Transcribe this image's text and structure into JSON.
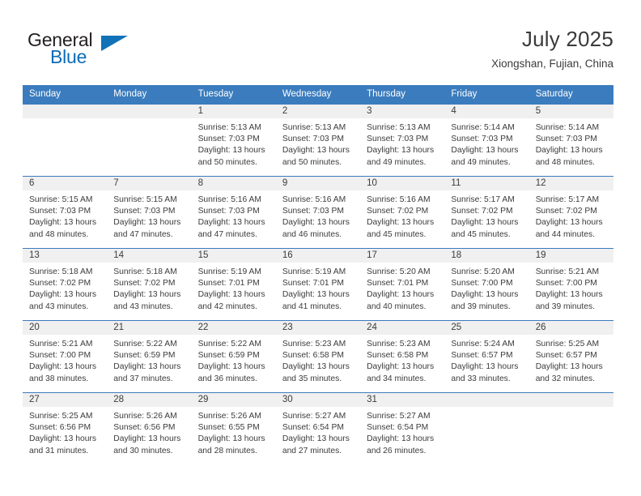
{
  "brand": {
    "word1": "General",
    "word2": "Blue",
    "triangle_color": "#1272b8",
    "blue": "#0a6cb8"
  },
  "header": {
    "title": "July 2025",
    "subtitle": "Xiongshan, Fujian, China"
  },
  "theme": {
    "header_bg": "#3a7cbe",
    "daynum_bg": "#f0f0f0",
    "text": "#3b3b3b"
  },
  "weekday_headers": [
    "Sunday",
    "Monday",
    "Tuesday",
    "Wednesday",
    "Thursday",
    "Friday",
    "Saturday"
  ],
  "weeks": [
    [
      {
        "day": ""
      },
      {
        "day": ""
      },
      {
        "day": "1",
        "sunrise": "Sunrise: 5:13 AM",
        "sunset": "Sunset: 7:03 PM",
        "daylight": "Daylight: 13 hours and 50 minutes."
      },
      {
        "day": "2",
        "sunrise": "Sunrise: 5:13 AM",
        "sunset": "Sunset: 7:03 PM",
        "daylight": "Daylight: 13 hours and 50 minutes."
      },
      {
        "day": "3",
        "sunrise": "Sunrise: 5:13 AM",
        "sunset": "Sunset: 7:03 PM",
        "daylight": "Daylight: 13 hours and 49 minutes."
      },
      {
        "day": "4",
        "sunrise": "Sunrise: 5:14 AM",
        "sunset": "Sunset: 7:03 PM",
        "daylight": "Daylight: 13 hours and 49 minutes."
      },
      {
        "day": "5",
        "sunrise": "Sunrise: 5:14 AM",
        "sunset": "Sunset: 7:03 PM",
        "daylight": "Daylight: 13 hours and 48 minutes."
      }
    ],
    [
      {
        "day": "6",
        "sunrise": "Sunrise: 5:15 AM",
        "sunset": "Sunset: 7:03 PM",
        "daylight": "Daylight: 13 hours and 48 minutes."
      },
      {
        "day": "7",
        "sunrise": "Sunrise: 5:15 AM",
        "sunset": "Sunset: 7:03 PM",
        "daylight": "Daylight: 13 hours and 47 minutes."
      },
      {
        "day": "8",
        "sunrise": "Sunrise: 5:16 AM",
        "sunset": "Sunset: 7:03 PM",
        "daylight": "Daylight: 13 hours and 47 minutes."
      },
      {
        "day": "9",
        "sunrise": "Sunrise: 5:16 AM",
        "sunset": "Sunset: 7:03 PM",
        "daylight": "Daylight: 13 hours and 46 minutes."
      },
      {
        "day": "10",
        "sunrise": "Sunrise: 5:16 AM",
        "sunset": "Sunset: 7:02 PM",
        "daylight": "Daylight: 13 hours and 45 minutes."
      },
      {
        "day": "11",
        "sunrise": "Sunrise: 5:17 AM",
        "sunset": "Sunset: 7:02 PM",
        "daylight": "Daylight: 13 hours and 45 minutes."
      },
      {
        "day": "12",
        "sunrise": "Sunrise: 5:17 AM",
        "sunset": "Sunset: 7:02 PM",
        "daylight": "Daylight: 13 hours and 44 minutes."
      }
    ],
    [
      {
        "day": "13",
        "sunrise": "Sunrise: 5:18 AM",
        "sunset": "Sunset: 7:02 PM",
        "daylight": "Daylight: 13 hours and 43 minutes."
      },
      {
        "day": "14",
        "sunrise": "Sunrise: 5:18 AM",
        "sunset": "Sunset: 7:02 PM",
        "daylight": "Daylight: 13 hours and 43 minutes."
      },
      {
        "day": "15",
        "sunrise": "Sunrise: 5:19 AM",
        "sunset": "Sunset: 7:01 PM",
        "daylight": "Daylight: 13 hours and 42 minutes."
      },
      {
        "day": "16",
        "sunrise": "Sunrise: 5:19 AM",
        "sunset": "Sunset: 7:01 PM",
        "daylight": "Daylight: 13 hours and 41 minutes."
      },
      {
        "day": "17",
        "sunrise": "Sunrise: 5:20 AM",
        "sunset": "Sunset: 7:01 PM",
        "daylight": "Daylight: 13 hours and 40 minutes."
      },
      {
        "day": "18",
        "sunrise": "Sunrise: 5:20 AM",
        "sunset": "Sunset: 7:00 PM",
        "daylight": "Daylight: 13 hours and 39 minutes."
      },
      {
        "day": "19",
        "sunrise": "Sunrise: 5:21 AM",
        "sunset": "Sunset: 7:00 PM",
        "daylight": "Daylight: 13 hours and 39 minutes."
      }
    ],
    [
      {
        "day": "20",
        "sunrise": "Sunrise: 5:21 AM",
        "sunset": "Sunset: 7:00 PM",
        "daylight": "Daylight: 13 hours and 38 minutes."
      },
      {
        "day": "21",
        "sunrise": "Sunrise: 5:22 AM",
        "sunset": "Sunset: 6:59 PM",
        "daylight": "Daylight: 13 hours and 37 minutes."
      },
      {
        "day": "22",
        "sunrise": "Sunrise: 5:22 AM",
        "sunset": "Sunset: 6:59 PM",
        "daylight": "Daylight: 13 hours and 36 minutes."
      },
      {
        "day": "23",
        "sunrise": "Sunrise: 5:23 AM",
        "sunset": "Sunset: 6:58 PM",
        "daylight": "Daylight: 13 hours and 35 minutes."
      },
      {
        "day": "24",
        "sunrise": "Sunrise: 5:23 AM",
        "sunset": "Sunset: 6:58 PM",
        "daylight": "Daylight: 13 hours and 34 minutes."
      },
      {
        "day": "25",
        "sunrise": "Sunrise: 5:24 AM",
        "sunset": "Sunset: 6:57 PM",
        "daylight": "Daylight: 13 hours and 33 minutes."
      },
      {
        "day": "26",
        "sunrise": "Sunrise: 5:25 AM",
        "sunset": "Sunset: 6:57 PM",
        "daylight": "Daylight: 13 hours and 32 minutes."
      }
    ],
    [
      {
        "day": "27",
        "sunrise": "Sunrise: 5:25 AM",
        "sunset": "Sunset: 6:56 PM",
        "daylight": "Daylight: 13 hours and 31 minutes."
      },
      {
        "day": "28",
        "sunrise": "Sunrise: 5:26 AM",
        "sunset": "Sunset: 6:56 PM",
        "daylight": "Daylight: 13 hours and 30 minutes."
      },
      {
        "day": "29",
        "sunrise": "Sunrise: 5:26 AM",
        "sunset": "Sunset: 6:55 PM",
        "daylight": "Daylight: 13 hours and 28 minutes."
      },
      {
        "day": "30",
        "sunrise": "Sunrise: 5:27 AM",
        "sunset": "Sunset: 6:54 PM",
        "daylight": "Daylight: 13 hours and 27 minutes."
      },
      {
        "day": "31",
        "sunrise": "Sunrise: 5:27 AM",
        "sunset": "Sunset: 6:54 PM",
        "daylight": "Daylight: 13 hours and 26 minutes."
      },
      {
        "day": ""
      },
      {
        "day": ""
      }
    ]
  ]
}
